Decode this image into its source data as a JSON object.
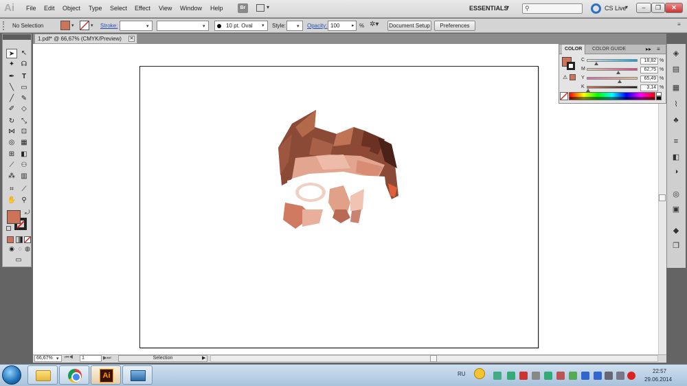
{
  "app": {
    "logo": "Ai"
  },
  "menu": [
    "File",
    "Edit",
    "Object",
    "Type",
    "Select",
    "Effect",
    "View",
    "Window",
    "Help"
  ],
  "menubar": {
    "bridge": "Br",
    "workspace": "ESSENTIALS",
    "cslive": "CS Live",
    "minimize": "–",
    "restore": "❐",
    "close": "✕"
  },
  "control": {
    "selection_status": "No Selection",
    "stroke_label": "Stroke:",
    "brush": "10 pt. Oval",
    "style_label": "Style:",
    "opacity_label": "Opacity:",
    "opacity_value": "100",
    "opacity_unit": "%",
    "document_setup": "Document Setup",
    "preferences": "Preferences",
    "fill_color": "#cc7358"
  },
  "document": {
    "tab_title": "1.pdf* @ 66,67% (CMYK/Preview)",
    "tab_close": "✕"
  },
  "status": {
    "zoom": "66,67%",
    "page": "1",
    "tool": "Selection"
  },
  "color_panel": {
    "tabs": [
      "COLOR",
      "COLOR GUIDE"
    ],
    "channels": [
      {
        "label": "C",
        "value": "18,82",
        "fraction": 0.1882,
        "gradient": [
          "#e0e0e0",
          "#00a8e0"
        ]
      },
      {
        "label": "M",
        "value": "62,75",
        "fraction": 0.6275,
        "gradient": [
          "#d8c9a8",
          "#e2418a"
        ]
      },
      {
        "label": "Y",
        "value": "65,49",
        "fraction": 0.6549,
        "gradient": [
          "#d86cb0",
          "#e6c48a"
        ]
      },
      {
        "label": "K",
        "value": "3,14",
        "fraction": 0.0314,
        "gradient": [
          "#cc7358",
          "#1a1a1a"
        ]
      }
    ],
    "pct": "%"
  },
  "taskbar": {
    "lang": "RU",
    "time": "22:57",
    "date": "29.06.2014",
    "ai_label": "Ai"
  }
}
